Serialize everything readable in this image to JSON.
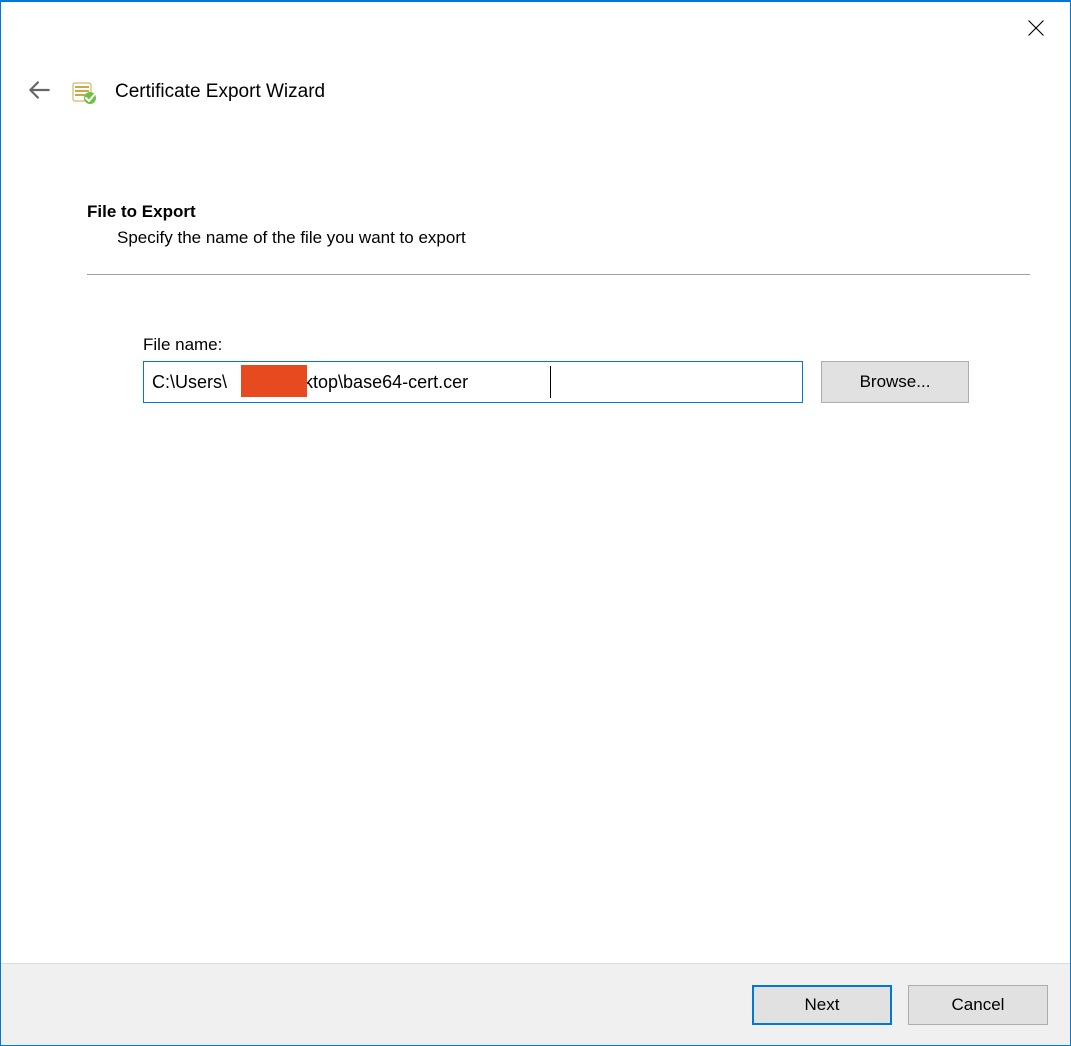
{
  "header": {
    "title": "Certificate Export Wizard"
  },
  "section": {
    "heading": "File to Export",
    "description": "Specify the name of the file you want to export"
  },
  "field": {
    "label": "File name:",
    "value": "C:\\Users\\        \\Desktop\\base64-cert.cer",
    "browse_label": "Browse...",
    "caret_left_px": "407"
  },
  "footer": {
    "next_label": "Next",
    "cancel_label": "Cancel"
  }
}
